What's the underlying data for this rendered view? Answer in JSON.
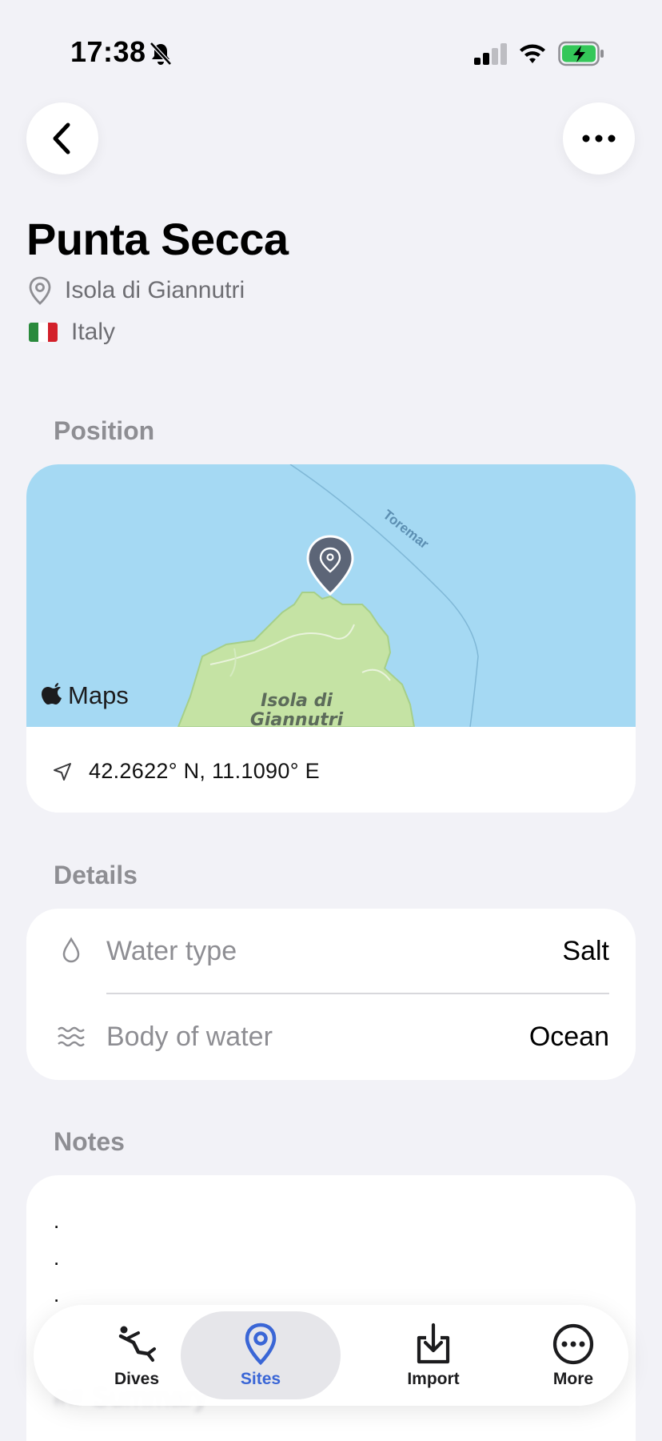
{
  "status_bar": {
    "time": "17:38"
  },
  "site": {
    "name": "Punta Secca",
    "location": "Isola di Giannutri",
    "country": "Italy",
    "flag_colors": [
      "#2a8a3c",
      "#ffffff",
      "#d3202a"
    ]
  },
  "position": {
    "section_label": "Position",
    "coordinates": "42.2622° N, 11.1090° E",
    "map": {
      "attribution": "Maps",
      "island_label_line1": "Isola di",
      "island_label_line2": "Giannutri",
      "ferry_label": "Toremar",
      "water_color": "#a5d9f3",
      "land_color": "#c5e3a4"
    }
  },
  "details": {
    "section_label": "Details",
    "rows": [
      {
        "label": "Water type",
        "value": "Salt",
        "icon": "drop-icon"
      },
      {
        "label": "Body of water",
        "value": "Ocean",
        "icon": "waves-icon"
      }
    ]
  },
  "notes": {
    "section_label": "Notes",
    "lines": [
      ".",
      ".",
      "."
    ],
    "partial_heading": "## Summary"
  },
  "tab_bar": {
    "items": [
      {
        "label": "Dives",
        "icon": "diver-icon"
      },
      {
        "label": "Sites",
        "icon": "pin-icon",
        "selected": true
      },
      {
        "label": "Import",
        "icon": "import-icon"
      },
      {
        "label": "More",
        "icon": "ellipsis-circle-icon"
      }
    ],
    "accent_color": "#3a66d6"
  }
}
